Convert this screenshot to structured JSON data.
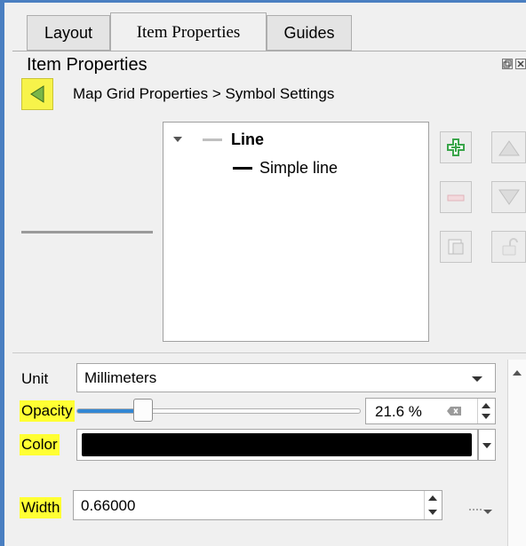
{
  "tabs": [
    {
      "label": "Layout",
      "active": false
    },
    {
      "label": "Item Properties",
      "active": true
    },
    {
      "label": "Guides",
      "active": false
    }
  ],
  "panel": {
    "title": "Item Properties",
    "dock_buttons": [
      "float",
      "close"
    ]
  },
  "breadcrumb": {
    "back_icon": "back-arrow-icon",
    "text": "Map Grid Properties > Symbol Settings"
  },
  "symbol_tree": {
    "root_label": "Line",
    "child_label": "Simple line"
  },
  "layer_buttons": [
    "add-layer-icon",
    "move-up-icon",
    "remove-layer-icon",
    "move-down-icon",
    "duplicate-layer-icon",
    "lock-icon"
  ],
  "properties": {
    "unit_label": "Unit",
    "unit_value": "Millimeters",
    "opacity_label": "Opacity",
    "opacity_value": "21.6 %",
    "opacity_fraction": 0.216,
    "color_label": "Color",
    "color_value": "#000000",
    "width_label": "Width",
    "width_value": "0.66000",
    "data_defined_icon": "data-defined-override-icon"
  },
  "colors": {
    "highlight": "#ffff33",
    "back_button": "#f7f34a",
    "slider_fill": "#3287d4",
    "frame": "#4a7fc1",
    "add_icon": "#3aa54a"
  }
}
